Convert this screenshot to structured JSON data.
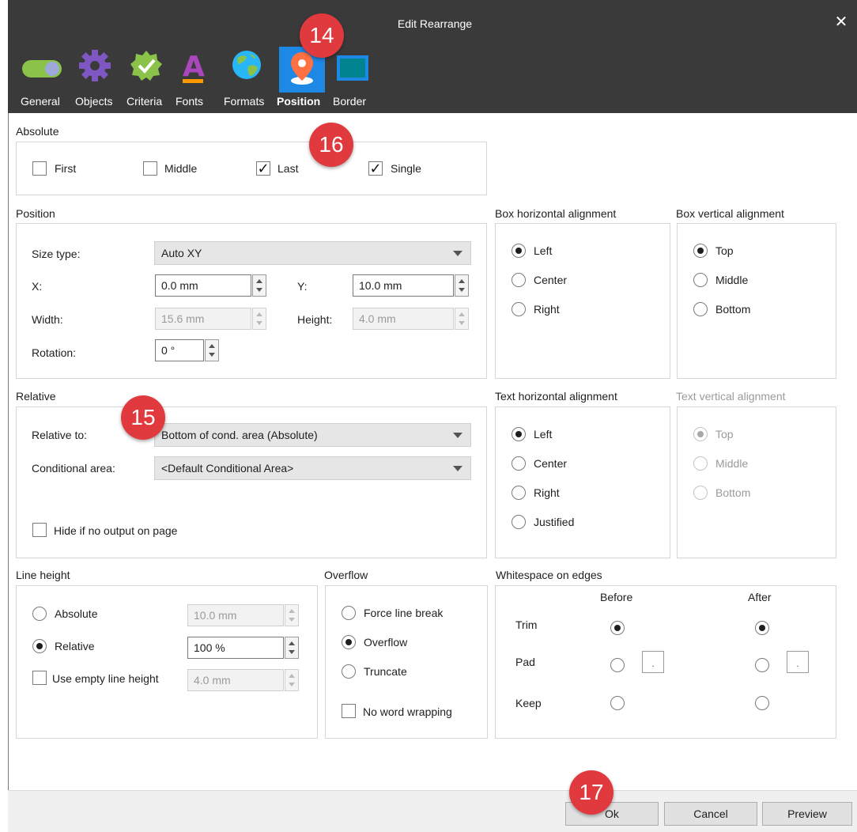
{
  "window": {
    "title": "Edit Rearrange"
  },
  "toolbar": {
    "tabs": [
      {
        "label": "General",
        "icon": "toggle-icon"
      },
      {
        "label": "Objects",
        "icon": "gear-icon"
      },
      {
        "label": "Criteria",
        "icon": "check-badge-icon"
      },
      {
        "label": "Fonts",
        "icon": "font-icon"
      },
      {
        "label": "Formats",
        "icon": "globe-icon"
      },
      {
        "label": "Position",
        "icon": "location-pin-icon",
        "active": true
      },
      {
        "label": "Border",
        "icon": "border-icon"
      }
    ]
  },
  "absolute": {
    "label": "Absolute",
    "first": {
      "label": "First",
      "checked": false
    },
    "middle": {
      "label": "Middle",
      "checked": false
    },
    "last": {
      "label": "Last",
      "checked": true
    },
    "single": {
      "label": "Single",
      "checked": true
    }
  },
  "position": {
    "label": "Position",
    "size_type_label": "Size type:",
    "size_type_value": "Auto XY",
    "x_label": "X:",
    "x_value": "0.0 mm",
    "y_label": "Y:",
    "y_value": "10.0 mm",
    "width_label": "Width:",
    "width_value": "15.6 mm",
    "height_label": "Height:",
    "height_value": "4.0 mm",
    "rotation_label": "Rotation:",
    "rotation_value": "0 °"
  },
  "box_h_align": {
    "label": "Box horizontal alignment",
    "options": [
      "Left",
      "Center",
      "Right"
    ],
    "selected": "Left"
  },
  "box_v_align": {
    "label": "Box vertical alignment",
    "options": [
      "Top",
      "Middle",
      "Bottom"
    ],
    "selected": "Top"
  },
  "relative": {
    "label": "Relative",
    "relative_to_label": "Relative to:",
    "relative_to_value": "Bottom of cond. area (Absolute)",
    "cond_area_label": "Conditional area:",
    "cond_area_value": "<Default Conditional Area>",
    "hide_label": "Hide if no output on page",
    "hide_checked": false
  },
  "text_h_align": {
    "label": "Text horizontal alignment",
    "options": [
      "Left",
      "Center",
      "Right",
      "Justified"
    ],
    "selected": "Left"
  },
  "text_v_align": {
    "label": "Text vertical alignment",
    "options": [
      "Top",
      "Middle",
      "Bottom"
    ],
    "selected": "Top",
    "disabled": true
  },
  "line_height": {
    "label": "Line height",
    "absolute_label": "Absolute",
    "absolute_value": "10.0 mm",
    "relative_label": "Relative",
    "relative_value": "100 %",
    "selected": "Relative",
    "empty_label": "Use empty line height",
    "empty_value": "4.0 mm",
    "empty_checked": false
  },
  "overflow": {
    "label": "Overflow",
    "options": [
      "Force line break",
      "Overflow",
      "Truncate"
    ],
    "selected": "Overflow",
    "no_wrap_label": "No word wrapping",
    "no_wrap_checked": false
  },
  "whitespace": {
    "label": "Whitespace on edges",
    "before": "Before",
    "after": "After",
    "rows": [
      "Trim",
      "Pad",
      "Keep"
    ],
    "pad_value": ".",
    "selected_before": "Trim",
    "selected_after": "Trim"
  },
  "buttons": {
    "ok": "Ok",
    "cancel": "Cancel",
    "preview": "Preview"
  },
  "badges": {
    "b14": "14",
    "b15": "15",
    "b16": "16",
    "b17": "17"
  },
  "colors": {
    "header": "#3a3a3a",
    "active_tab": "#1e88e5",
    "badge": "#e0393e"
  }
}
